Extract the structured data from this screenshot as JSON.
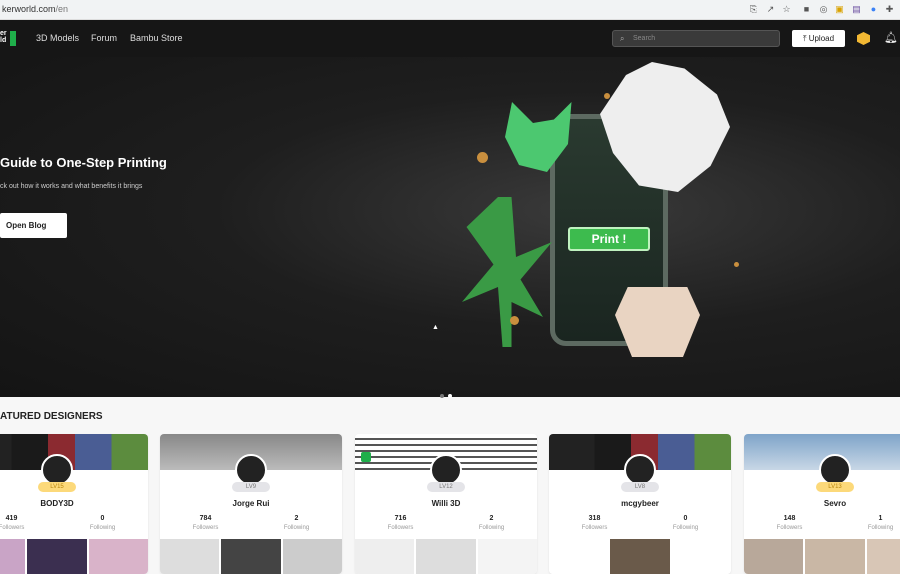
{
  "browser": {
    "url_host": "kerworld.com",
    "url_path": "/en"
  },
  "nav": {
    "logo": "MakerWorld",
    "logo_top": "er",
    "logo_bottom": "ld",
    "links": [
      "3D Models",
      "Forum",
      "Bambu Store"
    ],
    "search_placeholder": "Search",
    "upload_label": "Upload"
  },
  "hero": {
    "title": "Guide to One-Step Printing",
    "subtitle": "ck out how it works and what benefits it brings",
    "button": "Open Blog",
    "print_label": "Print !",
    "slides": 2,
    "active_slide": 2
  },
  "section_title": "ATURED DESIGNERS",
  "designers": [
    {
      "name": "BODY3D",
      "level": "LV15",
      "tier": "gold",
      "followers": "419",
      "following": "0",
      "followers_label": "Followers",
      "following_label": "Following"
    },
    {
      "name": "Jorge Rui",
      "level": "LV9",
      "tier": "gray",
      "followers": "784",
      "following": "2",
      "followers_label": "Followers",
      "following_label": "Following"
    },
    {
      "name": "Willi 3D",
      "level": "LV12",
      "tier": "gray",
      "followers": "716",
      "following": "2",
      "followers_label": "Followers",
      "following_label": "Following"
    },
    {
      "name": "mcgybeer",
      "level": "LV8",
      "tier": "gray",
      "followers": "318",
      "following": "0",
      "followers_label": "Followers",
      "following_label": "Following"
    },
    {
      "name": "Sevro",
      "level": "LV13",
      "tier": "gold",
      "followers": "148",
      "following": "1",
      "followers_label": "Followers",
      "following_label": "Following"
    }
  ],
  "colors": {
    "brand": "#1fae4a",
    "nav_bg": "#161616",
    "print_button": "#3dbb4e",
    "gold": "#f2b833"
  }
}
